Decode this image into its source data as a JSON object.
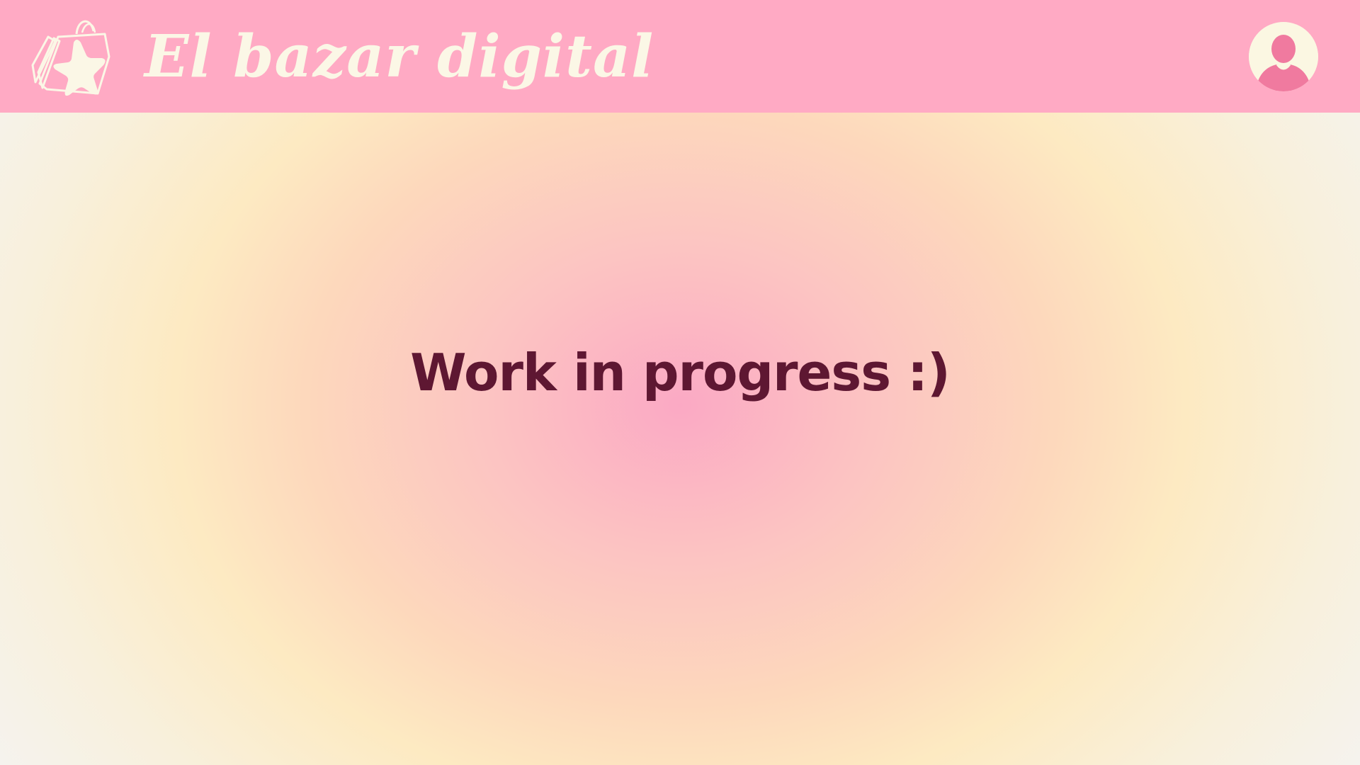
{
  "header": {
    "app_title": "El bazar digital",
    "logo_icon": "shopping-bag-star-icon",
    "avatar_icon": "user-avatar-icon",
    "background_color": "#ffaac4"
  },
  "main": {
    "message": "Work in progress :)"
  },
  "colors": {
    "accent_pink": "#ffaac4",
    "cream": "#fbf7e6",
    "text_dark": "#5e1732",
    "avatar_pink": "#f07a9f"
  }
}
